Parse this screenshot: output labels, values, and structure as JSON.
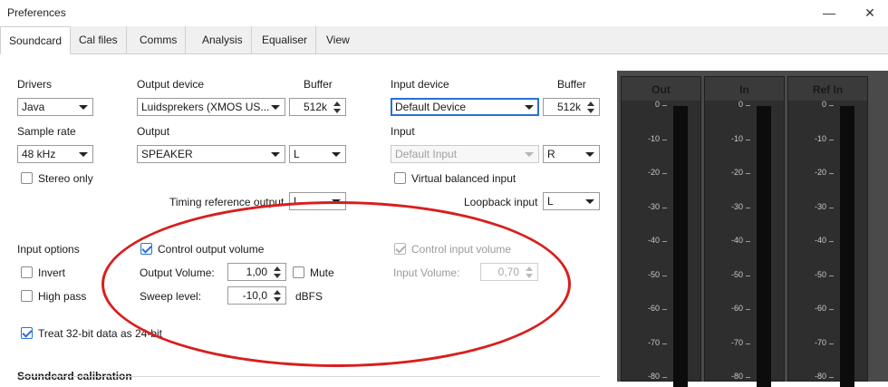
{
  "window": {
    "title": "Preferences",
    "minimize_icon": "minimize-icon",
    "close_icon": "close-icon"
  },
  "tabs": [
    "Soundcard",
    "Cal files",
    "Comms",
    "Analysis",
    "Equaliser",
    "View"
  ],
  "drivers": {
    "label": "Drivers",
    "value": "Java"
  },
  "output_device": {
    "label": "Output device",
    "value": "Luidsprekers (XMOS US..."
  },
  "output_buffer": {
    "label": "Buffer",
    "value": "512k"
  },
  "input_device": {
    "label": "Input device",
    "value": "Default Device"
  },
  "input_buffer": {
    "label": "Buffer",
    "value": "512k"
  },
  "sample_rate": {
    "label": "Sample rate",
    "value": "48 kHz"
  },
  "output": {
    "label": "Output",
    "value": "SPEAKER",
    "channel": "L"
  },
  "input": {
    "label": "Input",
    "value": "Default Input",
    "channel": "R"
  },
  "stereo_only": {
    "label": "Stereo only",
    "checked": false
  },
  "virtual_balanced": {
    "label": "Virtual balanced input",
    "checked": false
  },
  "timing_reference": {
    "label": "Timing reference output",
    "value": "L"
  },
  "loopback": {
    "label": "Loopback input",
    "value": "L"
  },
  "input_options": {
    "label": "Input options"
  },
  "invert": {
    "label": "Invert",
    "checked": false
  },
  "high_pass": {
    "label": "High pass",
    "checked": false
  },
  "control_output_volume": {
    "label": "Control output volume",
    "checked": true
  },
  "output_volume": {
    "label": "Output Volume:",
    "value": "1,00"
  },
  "mute": {
    "label": "Mute",
    "checked": false
  },
  "sweep_level": {
    "label": "Sweep level:",
    "value": "-10,0",
    "unit": "dBFS"
  },
  "control_input_volume": {
    "label": "Control input volume",
    "checked": true,
    "disabled": true
  },
  "input_volume": {
    "label": "Input Volume:",
    "value": "0,70"
  },
  "treat_32bit": {
    "label": "Treat 32-bit data as 24-bit",
    "checked": true
  },
  "soundcard_calibration": {
    "label": "Soundcard calibration"
  },
  "meters": {
    "titles": [
      "Out",
      "In",
      "Ref In"
    ],
    "ticks": [
      "0",
      "-10",
      "-20",
      "-30",
      "-40",
      "-50",
      "-60",
      "-70",
      "-80"
    ]
  },
  "colors": {
    "accent": "#2a6fd6",
    "annotation": "#d81e1e",
    "meter_bg": "#4a4a4a"
  }
}
